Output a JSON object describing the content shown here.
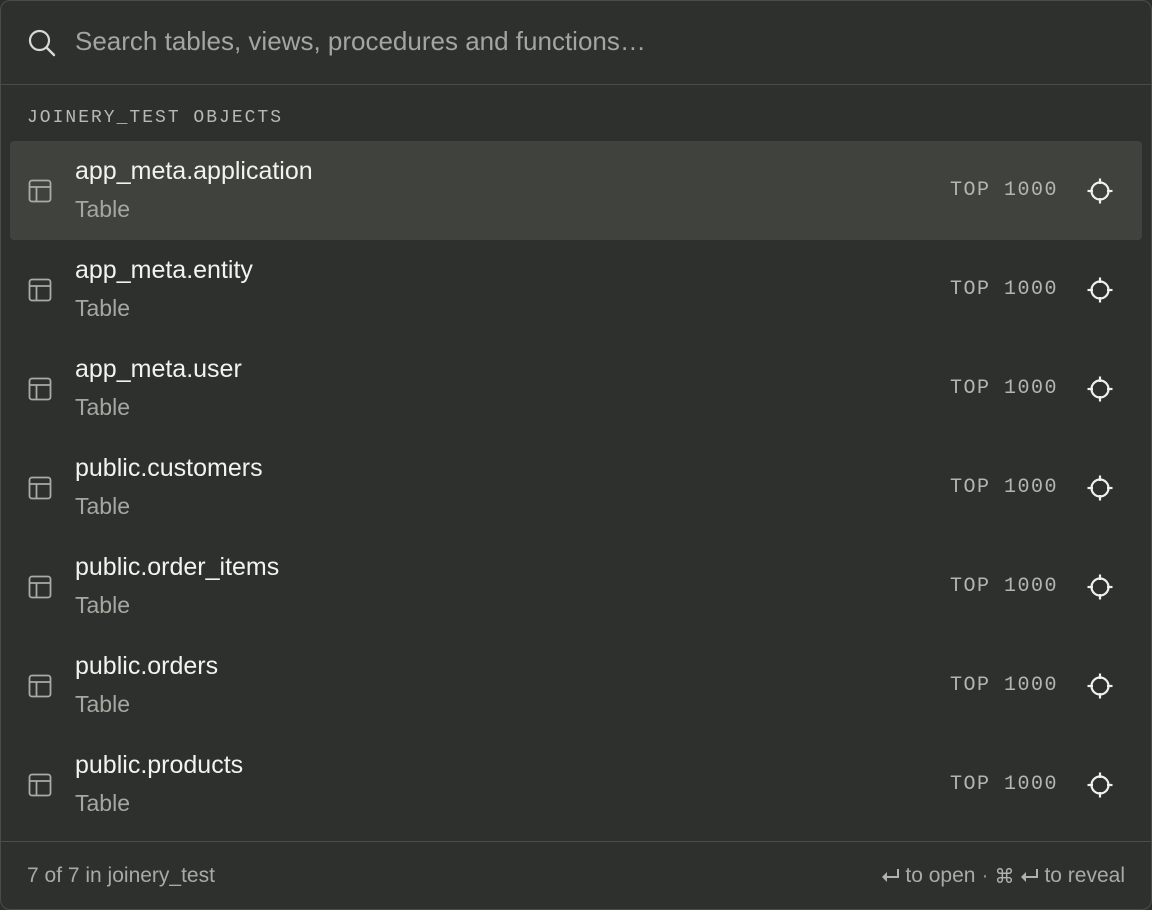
{
  "search": {
    "placeholder": "Search tables, views, procedures and functions…",
    "icon": "search-icon"
  },
  "section": {
    "heading": "JOINERY_TEST OBJECTS"
  },
  "items": [
    {
      "name": "app_meta.application",
      "kind": "Table",
      "action": "TOP 1000",
      "selected": true
    },
    {
      "name": "app_meta.entity",
      "kind": "Table",
      "action": "TOP 1000",
      "selected": false
    },
    {
      "name": "app_meta.user",
      "kind": "Table",
      "action": "TOP 1000",
      "selected": false
    },
    {
      "name": "public.customers",
      "kind": "Table",
      "action": "TOP 1000",
      "selected": false
    },
    {
      "name": "public.order_items",
      "kind": "Table",
      "action": "TOP 1000",
      "selected": false
    },
    {
      "name": "public.orders",
      "kind": "Table",
      "action": "TOP 1000",
      "selected": false
    },
    {
      "name": "public.products",
      "kind": "Table",
      "action": "TOP 1000",
      "selected": false
    }
  ],
  "footer": {
    "count": "7 of 7 in joinery_test",
    "open_hint": "to open",
    "separator": "·",
    "reveal_hint": "to reveal"
  },
  "colors": {
    "background": "#2e302d",
    "selected_row": "#40423d",
    "border": "#4a4c48",
    "text": "#ededea",
    "muted": "#a5a7a1"
  }
}
